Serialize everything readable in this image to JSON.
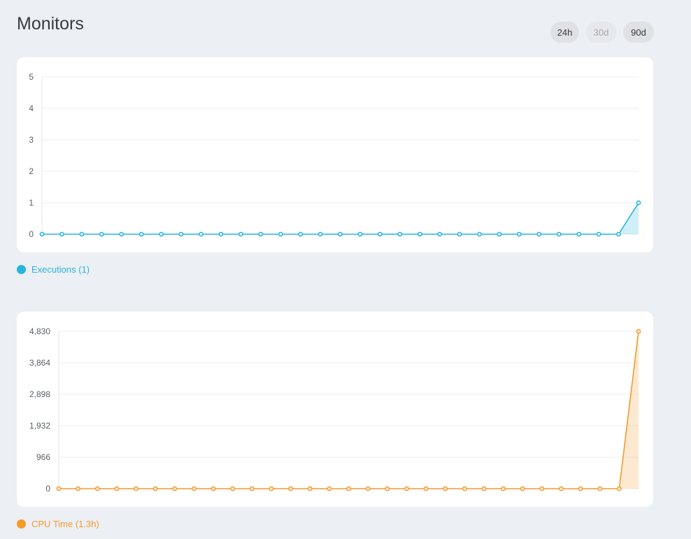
{
  "header": {
    "title": "Monitors"
  },
  "range": {
    "options": [
      {
        "label": "24h",
        "disabled": false
      },
      {
        "label": "30d",
        "disabled": true
      },
      {
        "label": "90d",
        "disabled": false
      }
    ]
  },
  "colors": {
    "executions": "#29b4df",
    "cpu": "#f5992b"
  },
  "chart_data": [
    {
      "type": "area",
      "title": "",
      "xlabel": "",
      "ylabel": "",
      "ylim": [
        0,
        5
      ],
      "yticks": [
        "0",
        "1",
        "2",
        "3",
        "4",
        "5"
      ],
      "grid": true,
      "legend": "bottom-left",
      "series": [
        {
          "name": "Executions (1)",
          "values": [
            0,
            0,
            0,
            0,
            0,
            0,
            0,
            0,
            0,
            0,
            0,
            0,
            0,
            0,
            0,
            0,
            0,
            0,
            0,
            0,
            0,
            0,
            0,
            0,
            0,
            0,
            0,
            0,
            0,
            0,
            1
          ]
        }
      ]
    },
    {
      "type": "area",
      "title": "",
      "xlabel": "",
      "ylabel": "",
      "ylim": [
        0,
        4830
      ],
      "yticks": [
        "0",
        "966",
        "1,932",
        "2,898",
        "3,864",
        "4,830"
      ],
      "grid": true,
      "legend": "bottom-left",
      "series": [
        {
          "name": "CPU Time (1.3h)",
          "values": [
            0,
            0,
            0,
            0,
            0,
            0,
            0,
            0,
            0,
            0,
            0,
            0,
            0,
            0,
            0,
            0,
            0,
            0,
            0,
            0,
            0,
            0,
            0,
            0,
            0,
            0,
            0,
            0,
            0,
            0,
            4830
          ]
        }
      ]
    }
  ]
}
